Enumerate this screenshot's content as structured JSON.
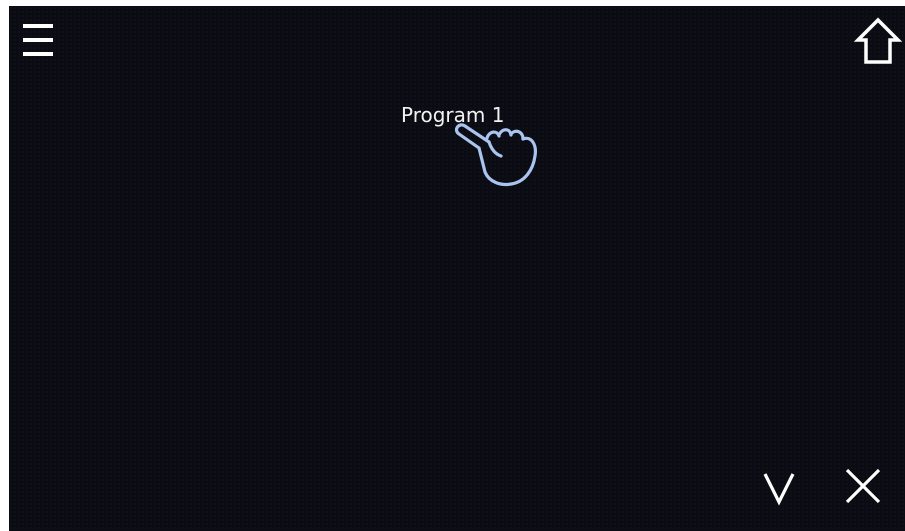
{
  "toolbar": {
    "menu_icon": "hamburger-menu-icon",
    "home_icon": "home-icon"
  },
  "program_list": {
    "items": [
      {
        "label": "Program 1"
      }
    ]
  },
  "footer": {
    "confirm_icon": "chevron-down-icon",
    "close_icon": "close-x-icon"
  },
  "overlay": {
    "pointer_icon": "tap-hand-icon"
  },
  "colors": {
    "background": "#0b0b13",
    "foreground": "#ffffff",
    "hand_outline": "#a9c4ef"
  }
}
